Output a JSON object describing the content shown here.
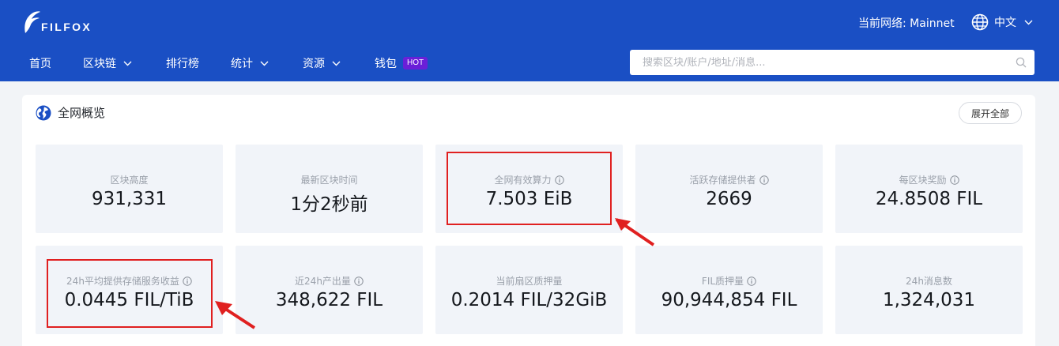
{
  "header": {
    "logo_text": "FILFOX",
    "network_label": "当前网络: Mainnet",
    "language": "中文"
  },
  "nav": {
    "items": [
      {
        "label": "首页",
        "dropdown": false
      },
      {
        "label": "区块链",
        "dropdown": true
      },
      {
        "label": "排行榜",
        "dropdown": false
      },
      {
        "label": "统计",
        "dropdown": true
      },
      {
        "label": "资源",
        "dropdown": true
      },
      {
        "label": "钱包",
        "dropdown": false,
        "badge": "HOT"
      }
    ]
  },
  "search": {
    "placeholder": "搜索区块/账户/地址/消息..."
  },
  "overview": {
    "title": "全网概览",
    "expand_label": "展开全部",
    "cards": [
      {
        "label": "区块高度",
        "value": "931,331",
        "info": false
      },
      {
        "label": "最新区块时间",
        "value": "1分2秒前",
        "info": false
      },
      {
        "label": "全网有效算力",
        "value": "7.503 EiB",
        "info": true
      },
      {
        "label": "活跃存储提供者",
        "value": "2669",
        "info": true
      },
      {
        "label": "每区块奖励",
        "value": "24.8508 FIL",
        "info": true
      },
      {
        "label": "24h平均提供存储服务收益",
        "value": "0.0445 FIL/TiB",
        "info": true
      },
      {
        "label": "近24h产出量",
        "value": "348,622 FIL",
        "info": true
      },
      {
        "label": "当前扇区质押量",
        "value": "0.2014 FIL/32GiB",
        "info": false
      },
      {
        "label": "FIL质押量",
        "value": "90,944,854 FIL",
        "info": true
      },
      {
        "label": "24h消息数",
        "value": "1,324,031",
        "info": false
      }
    ]
  },
  "colors": {
    "header_bg": "#1a4fc4",
    "hot_badge": "#6a1fd8",
    "annotation_red": "#e02020"
  }
}
